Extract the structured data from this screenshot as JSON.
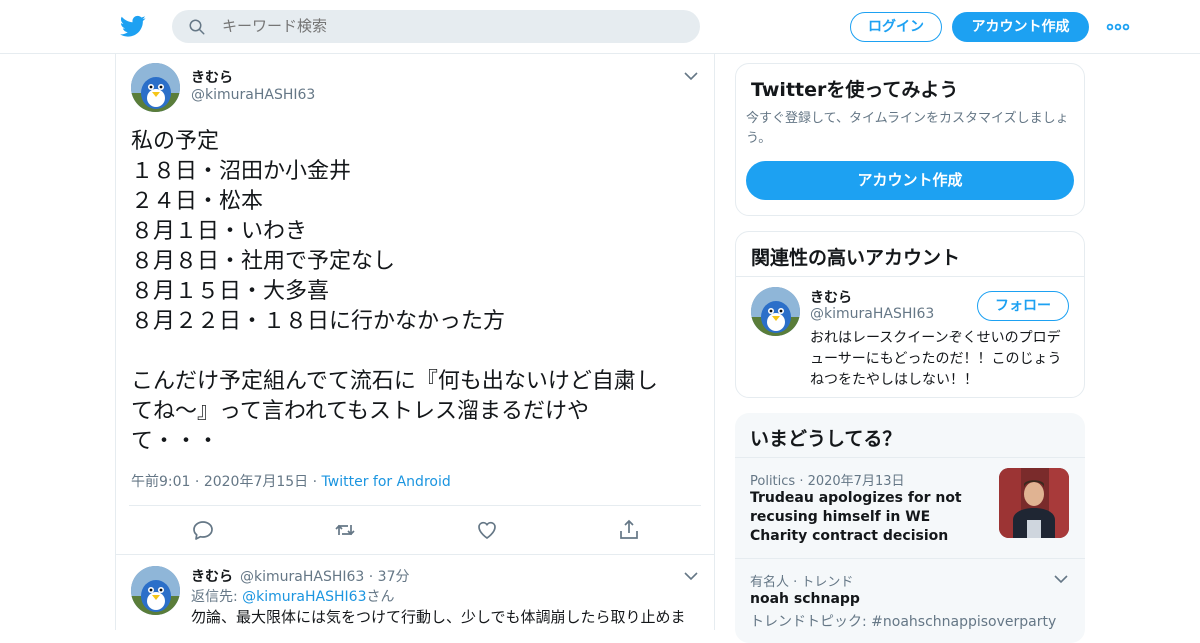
{
  "header": {
    "search_placeholder": "キーワード検索",
    "login_label": "ログイン",
    "signup_label": "アカウント作成",
    "brand_color": "#1da1f2",
    "icons": [
      "twitter-bird-icon",
      "search-icon",
      "more-icon"
    ]
  },
  "tweet": {
    "name": "きむら",
    "handle": "@kimuraHASHI63",
    "lines": [
      "私の予定",
      "１８日・沼田か小金井",
      "２４日・松本",
      "８月１日・いわき",
      "８月８日・社用で予定なし",
      "８月１５日・大多喜",
      "８月２２日・１８日に行かなかった方",
      "",
      "こんだけ予定組んでて流石に『何も出ないけど自粛し",
      "てね～』って言われてもストレス溜まるだけや",
      "て・・・"
    ],
    "time": "午前9:01",
    "date": "2020年7月15日",
    "source": "Twitter for Android",
    "actions": [
      "reply-icon",
      "retweet-icon",
      "like-icon",
      "share-icon"
    ]
  },
  "reply": {
    "name": "きむら",
    "handle": "@kimuraHASHI63",
    "age": "37分",
    "reply_prefix": "返信先:",
    "reply_to": "@kimuraHASHI63",
    "reply_suffix": "さん",
    "text": "勿論、最大限体には気をつけて行動し、少しでも体調崩したら取り止めま"
  },
  "sidebar": {
    "signup_card": {
      "title": "Twitterを使ってみよう",
      "subtitle": "今すぐ登録して、タイムラインをカスタマイズしましょう。",
      "button": "アカウント作成"
    },
    "related_card": {
      "title": "関連性の高いアカウント",
      "name": "きむら",
      "handle": "@kimuraHASHI63",
      "follow": "フォロー",
      "bio": "おれはレースクイーンぞくせいのプロデューサーにもどったのだ！！このじょうねつをたやしはしない！！"
    },
    "trends_card": {
      "title": "いまどうしてる？",
      "item1_category": "Politics",
      "item1_date": "2020年7月13日",
      "item1_title": "Trudeau apologizes for not recusing himself in WE Charity contract decision",
      "item2_meta": "有名人 · トレンド",
      "item2_title": "noah schnapp",
      "item2_sub": "トレンドトピック: #noahschnappisoverparty"
    }
  }
}
